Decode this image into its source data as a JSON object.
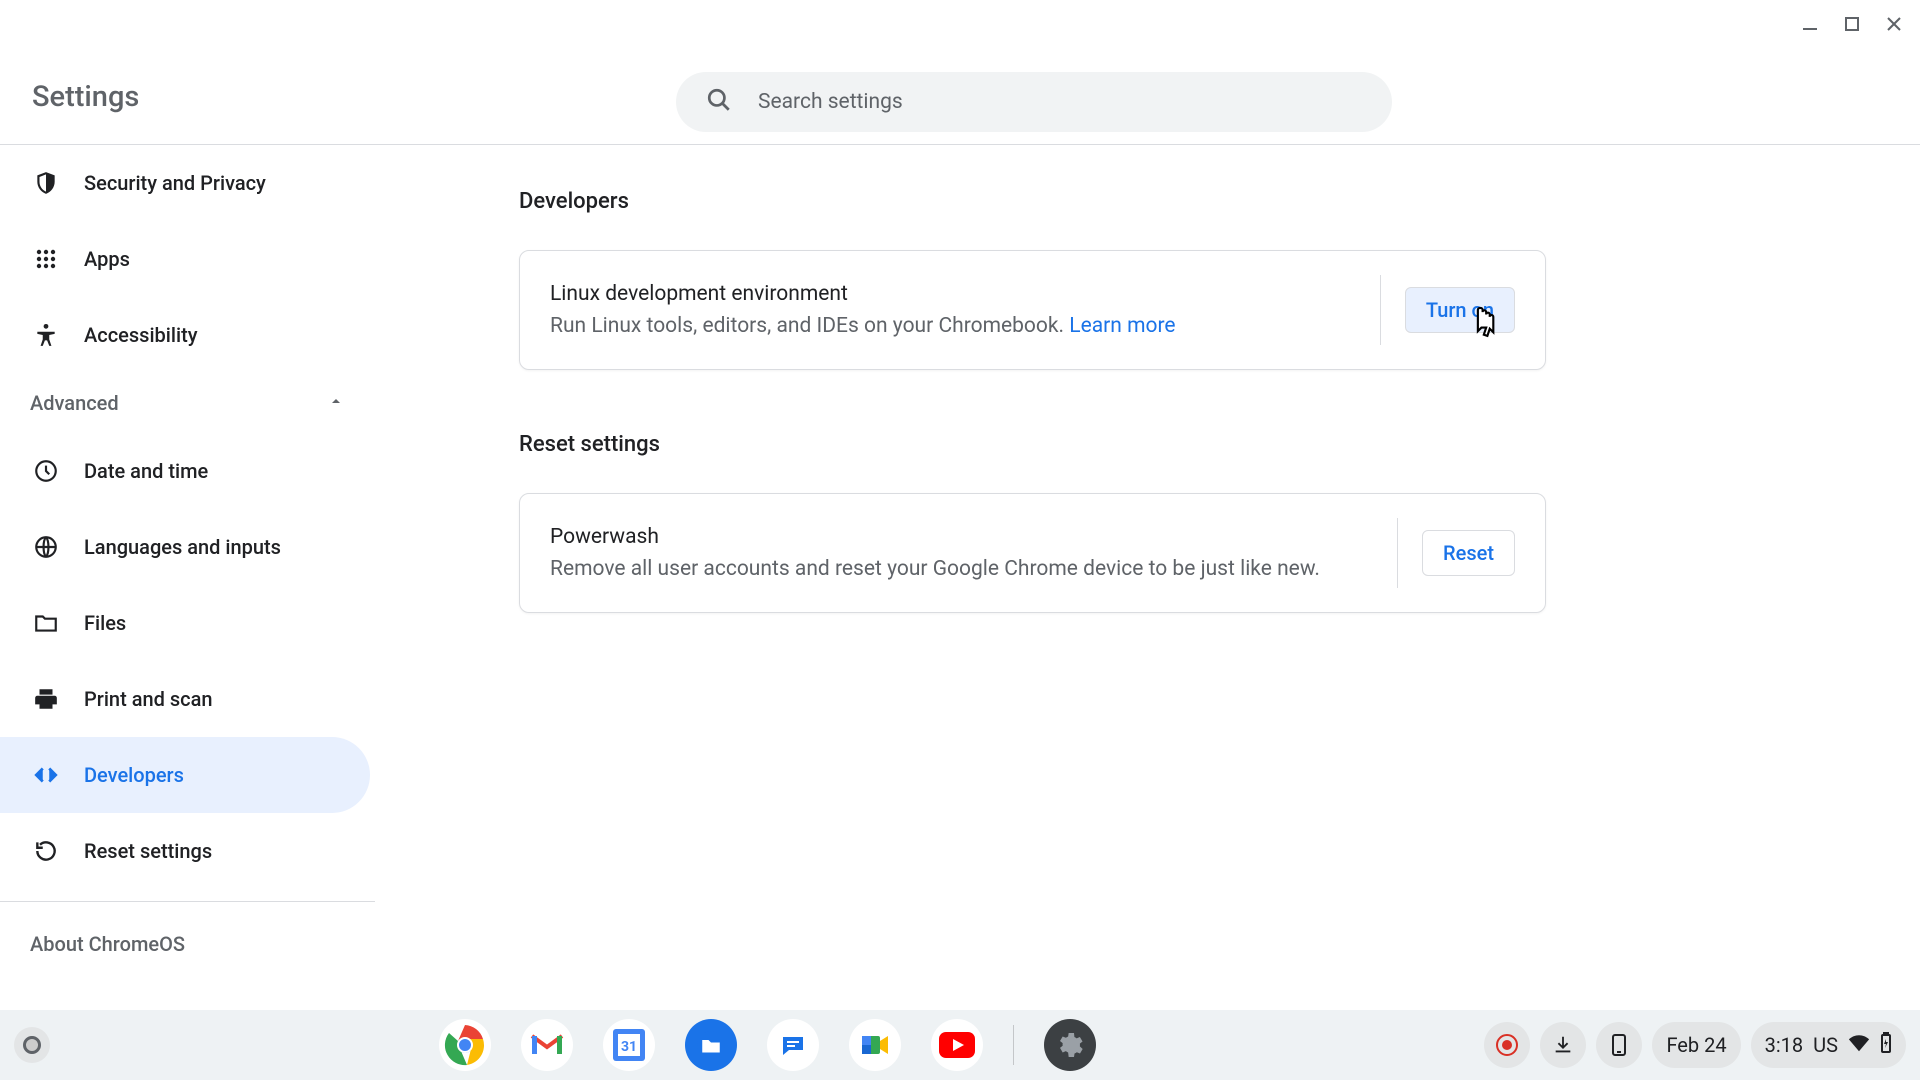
{
  "header": {
    "title": "Settings",
    "search_placeholder": "Search settings"
  },
  "sidebar": {
    "items_top": [
      {
        "label": "Security and Privacy",
        "icon": "shield"
      },
      {
        "label": "Apps",
        "icon": "apps"
      },
      {
        "label": "Accessibility",
        "icon": "accessibility"
      }
    ],
    "advanced_label": "Advanced",
    "advanced_expanded": true,
    "items_advanced": [
      {
        "label": "Date and time",
        "icon": "clock"
      },
      {
        "label": "Languages and inputs",
        "icon": "globe"
      },
      {
        "label": "Files",
        "icon": "folder"
      },
      {
        "label": "Print and scan",
        "icon": "printer"
      },
      {
        "label": "Developers",
        "icon": "code",
        "active": true
      },
      {
        "label": "Reset settings",
        "icon": "reset"
      }
    ],
    "about_label": "About ChromeOS"
  },
  "main": {
    "sections": [
      {
        "title": "Developers",
        "card_title": "Linux development environment",
        "card_desc": "Run Linux tools, editors, and IDEs on your Chromebook. ",
        "learn_more": "Learn more",
        "button": "Turn on",
        "button_style": "highlight"
      },
      {
        "title": "Reset settings",
        "card_title": "Powerwash",
        "card_desc": "Remove all user accounts and reset your Google Chrome device to be just like new.",
        "learn_more": "",
        "button": "Reset",
        "button_style": "plain"
      }
    ]
  },
  "taskbar": {
    "apps": [
      "chrome",
      "gmail",
      "calendar",
      "files",
      "messages",
      "meet",
      "youtube",
      "settings"
    ],
    "tray": {
      "recording": true,
      "downloads": true,
      "phone": true,
      "date": "Feb 24",
      "time": "3:18",
      "locale": "US"
    }
  }
}
